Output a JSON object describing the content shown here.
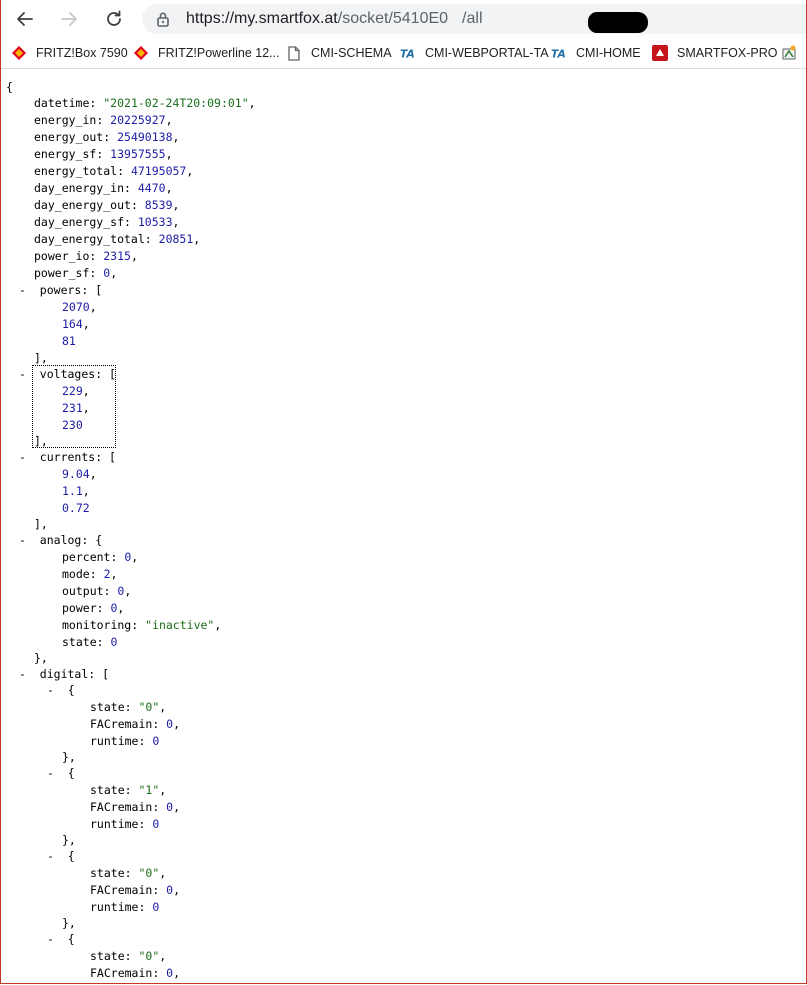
{
  "browser": {
    "url_host": "https://my.smartfox.at",
    "url_path_start": "/socket/5410E0",
    "url_path_end": "/all"
  },
  "bookmarks": [
    {
      "label": "FRITZ!Box 7590",
      "icon": "fritz-icon"
    },
    {
      "label": "FRITZ!Powerline 12...",
      "icon": "fritz-icon"
    },
    {
      "label": "CMI-SCHEMA",
      "icon": "page-icon"
    },
    {
      "label": "CMI-WEBPORTAL-TA",
      "icon": "ta-icon"
    },
    {
      "label": "CMI-HOME",
      "icon": "ta-icon"
    },
    {
      "label": "SMARTFOX-PRO",
      "icon": "smartfox-icon"
    }
  ],
  "json": {
    "datetime": "\"2021-02-24T20:09:01\"",
    "energy_in": "20225927",
    "energy_out": "25490138",
    "energy_sf": "13957555",
    "energy_total": "47195057",
    "day_energy_in": "4470",
    "day_energy_out": "8539",
    "day_energy_sf": "10533",
    "day_energy_total": "20851",
    "power_io": "2315",
    "power_sf": "0",
    "powers": [
      "2070",
      "164",
      "81"
    ],
    "voltages": [
      "229",
      "231",
      "230"
    ],
    "currents": [
      "9.04",
      "1.1",
      "0.72"
    ],
    "analog": {
      "percent": "0",
      "mode": "2",
      "output": "0",
      "power": "0",
      "monitoring": "\"inactive\"",
      "state": "0"
    },
    "digital": [
      {
        "state": "\"0\"",
        "FACremain": "0",
        "runtime": "0"
      },
      {
        "state": "\"1\"",
        "FACremain": "0",
        "runtime": "0"
      },
      {
        "state": "\"0\"",
        "FACremain": "0",
        "runtime": "0"
      },
      {
        "state": "\"0\"",
        "FACremain": "0"
      }
    ]
  },
  "colors": {
    "key": "#000000",
    "string": "#1a6d1a",
    "number": "#1c1ca8",
    "window_border": "#c0392b"
  }
}
